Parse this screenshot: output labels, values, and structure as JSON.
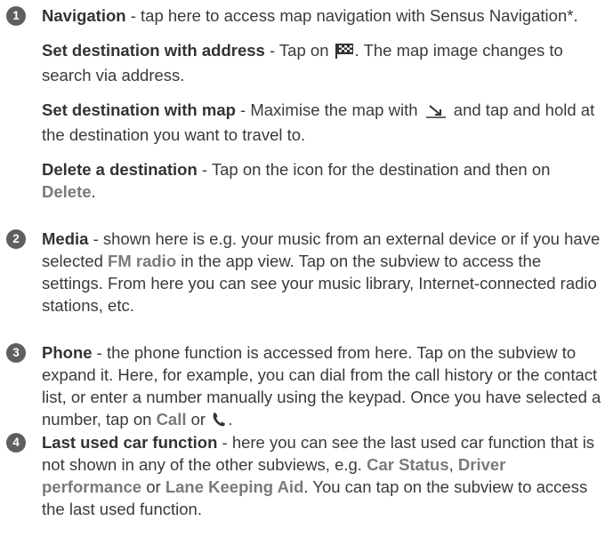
{
  "items": [
    {
      "number": "1",
      "title": "Navigation",
      "text": " - tap here to access map navigation with Sensus Navigation*.",
      "sub": [
        {
          "title": "Set destination with address",
          "pre": " - Tap on ",
          "icon": "checkered-flag-icon",
          "post": ". The map image changes to search via address."
        },
        {
          "title": "Set destination with map",
          "pre": " - Maximise the map with ",
          "icon": "expand-arrow-icon",
          "post": " and tap and hold at the destination you want to travel to."
        },
        {
          "title": "Delete a destination",
          "pre": " - Tap on the icon for the destination and then on ",
          "ui": "Delete",
          "post": "."
        }
      ]
    },
    {
      "number": "2",
      "title": "Media",
      "pre": " - shown here is e.g. your music from an external device or if you have selected ",
      "ui": "FM radio",
      "post": " in the app view. Tap on the subview to access the settings. From here you can see your music library, Internet-connected radio stations, etc."
    },
    {
      "number": "3",
      "title": "Phone",
      "pre": " - the phone function is accessed from here. Tap on the subview to expand it. Here, for example, you can dial from the call history or the contact list, or enter a number manually using the keypad. Once you have selected a number, tap on ",
      "ui": "Call",
      "mid": " or ",
      "icon": "phone-handset-icon",
      "post": "."
    },
    {
      "number": "4",
      "title": "Last used car function",
      "pre": " - here you can see the last used car function that is not shown in any of the other subviews, e.g. ",
      "ui1": "Car Status",
      "sep1": ", ",
      "ui2": "Driver performance",
      "sep2": " or ",
      "ui3": "Lane Keeping Aid",
      "post": ". You can tap on the subview to access the last used function."
    }
  ]
}
